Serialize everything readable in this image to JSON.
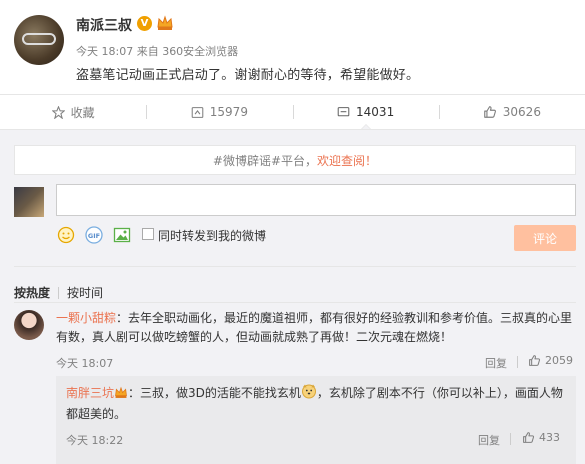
{
  "post": {
    "author": "南派三叔",
    "verified_badge": "V",
    "meta": "今天 18:07 来自 360安全浏览器",
    "text": "盗墓笔记动画正式启动了。谢谢耐心的等待，希望能做好。",
    "icons": [
      "avatar",
      "verified-icon",
      "crown-icon"
    ]
  },
  "actions": {
    "favorite_label": "收藏",
    "repost_count": "15979",
    "comment_count": "14031",
    "like_count": "30626"
  },
  "notice": {
    "prefix": "#微博辟谣#平台，",
    "highlight": "欢迎查阅！"
  },
  "composer": {
    "input_value": "",
    "repost_checkbox_label": "同时转发到我的微博",
    "submit_label": "评论",
    "tools": [
      "emoji-icon",
      "gif-icon",
      "image-icon"
    ]
  },
  "sort": {
    "by_hot": "按热度",
    "by_time": "按时间"
  },
  "comments": [
    {
      "user": "一颗小甜粽",
      "text": "：去年全职动画化，最近的魔道祖师，都有很好的经验教训和参考价值。三叔真的心里有数，真人剧可以做吃螃蟹的人，但动画就成熟了再做！二次元魂在燃烧！",
      "time": "今天 18:07",
      "reply_label": "回复",
      "likes": "2059"
    }
  ],
  "sub_comments": [
    {
      "user": "南胖三坑",
      "text_before_emoji": "：三叔，做3D的活能不能找玄机",
      "text_after_emoji": "，玄机除了剧本不行（你可以补上），画面人物都超美的。",
      "time": "今天 18:22",
      "reply_label": "回复",
      "likes": "433"
    }
  ],
  "colors": {
    "accent": "#eb7350",
    "badge": "#f0a000",
    "panel_bg": "#f2f2f5",
    "button_disabled": "#ffc09f"
  }
}
